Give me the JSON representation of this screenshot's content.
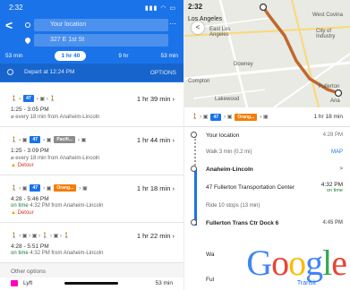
{
  "left": {
    "status_time": "2:32",
    "origin": "Your location",
    "destination": "327 E 1st St",
    "modes": [
      {
        "label": "53 min"
      },
      {
        "label": "1 hr 40",
        "selected": true
      },
      {
        "label": "9 hr"
      },
      {
        "label": "53 min"
      }
    ],
    "depart": "Depart at 12:24 PM",
    "options": "OPTIONS",
    "routes": [
      {
        "badges": [
          {
            "t": "47",
            "c": "blue"
          }
        ],
        "duration": "1 hr 39 min",
        "times": "1:25 - 3:05 PM",
        "freq": "every 18 min from Anaheim-Lincoln"
      },
      {
        "badges": [
          {
            "t": "47",
            "c": "blue"
          },
          {
            "t": "Pacifi...",
            "c": "gray"
          }
        ],
        "duration": "1 hr 44 min",
        "times": "1:25 - 3:09 PM",
        "freq": "every 18 min from Anaheim-Lincoln",
        "detour": "Detour"
      },
      {
        "badges": [
          {
            "t": "47",
            "c": "blue"
          },
          {
            "t": "Orang...",
            "c": "orange"
          }
        ],
        "duration": "1 hr 18 min",
        "times": "4:28 - 5:46 PM",
        "live": "on time",
        "freq": "4:32 PM from Anaheim-Lincoln",
        "detour": "Detour"
      },
      {
        "badges": [],
        "duration": "1 hr 22 min",
        "times": "4:28 - 5:51 PM",
        "live": "on time",
        "freq": "4:32 PM from Anaheim-Lincoln"
      }
    ],
    "other_options": "Other options",
    "lyft_label": "Lyft",
    "lyft_time": "53 min"
  },
  "right": {
    "status_time": "2:32",
    "map_labels": {
      "la": "Los Angeles",
      "east_la": "East Los Angeles",
      "west_covina": "West Covina",
      "city_industry": "City of Industry",
      "downey": "Downey",
      "compton": "Compton",
      "lakewood": "Lakewood",
      "fullerton": "Fullerton",
      "anaheim": "Ana"
    },
    "summary_badge": "Orang...",
    "summary_time": "1 hr 18 min",
    "itinerary": [
      {
        "label": "Your location",
        "time": "4:28 PM",
        "kind": "node"
      },
      {
        "label": "Walk 3 min (0.2 mi)",
        "time": "MAP",
        "kind": "sub"
      },
      {
        "label": "Anaheim-Lincoln",
        "time": ">",
        "kind": "node-bold"
      },
      {
        "label": "47 Fullerton Transportation Center",
        "time": "4:32 PM",
        "extra": "on time",
        "kind": "bus"
      },
      {
        "label": "Ride 10 stops (13 min)",
        "time": "",
        "kind": "sub"
      },
      {
        "label": "Fullerton Trans Ctr Dock 6",
        "time": "4:45 PM",
        "kind": "node-bold"
      }
    ],
    "wa_text": "Wa",
    "ful_text": "Ful",
    "logo": "Google",
    "logo_sub": "Transit",
    "colors": {
      "g_blue": "#4285F4",
      "g_red": "#EA4335",
      "g_yellow": "#FBBC05",
      "g_green": "#34A853"
    }
  }
}
